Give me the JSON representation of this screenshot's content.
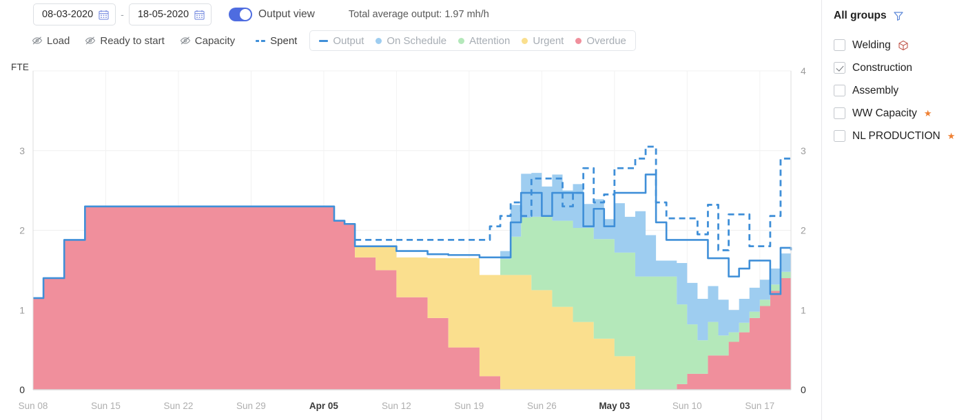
{
  "toolbar": {
    "date_from": "08-03-2020",
    "date_to": "18-05-2020",
    "date_separator": "-",
    "calendar_icon": "calendar-icon",
    "toggle_label": "Output view",
    "toggle_on": true,
    "total_average": "Total average output: 1.97 mh/h",
    "hidden_series": [
      {
        "label": "Load",
        "icon": "eye-slash-icon"
      },
      {
        "label": "Ready to start",
        "icon": "eye-slash-icon"
      },
      {
        "label": "Capacity",
        "icon": "eye-slash-icon"
      }
    ],
    "spent": {
      "label": "Spent",
      "color": "#3f8fd8"
    },
    "legend": [
      {
        "label": "Output",
        "color": "#3f8fd8",
        "marker": "line"
      },
      {
        "label": "On Schedule",
        "color": "#9ecdf0",
        "marker": "dot"
      },
      {
        "label": "Attention",
        "color": "#b4e8ba",
        "marker": "dot"
      },
      {
        "label": "Urgent",
        "color": "#fadf8e",
        "marker": "dot"
      },
      {
        "label": "Overdue",
        "color": "#f08f9c",
        "marker": "dot"
      }
    ]
  },
  "groups": {
    "title": "All groups",
    "filter_icon": "funnel-icon",
    "items": [
      {
        "label": "Welding",
        "checked": false,
        "badge": "cube-icon"
      },
      {
        "label": "Construction",
        "checked": true,
        "badge": ""
      },
      {
        "label": "Assembly",
        "checked": false,
        "badge": ""
      },
      {
        "label": "WW Capacity",
        "checked": false,
        "badge": "star-icon"
      },
      {
        "label": "NL PRODUCTION",
        "checked": false,
        "badge": "star-icon"
      }
    ]
  },
  "chart_data": {
    "type": "area",
    "title": "",
    "ylabel": "FTE",
    "xlabel": "",
    "ylim": [
      0,
      4
    ],
    "y_ticks": [
      0,
      1,
      2,
      3,
      4
    ],
    "y_ticks_left": [
      0,
      1,
      2,
      3
    ],
    "y_ticks_right": [
      0,
      1,
      2,
      3,
      4
    ],
    "grid": true,
    "legend_position": "top",
    "x_tick_labels": [
      "Sun 08",
      "Sun 15",
      "Sun 22",
      "Sun 29",
      "Apr 05",
      "Sun 12",
      "Sun 19",
      "Sun 26",
      "May 03",
      "Sun 10",
      "Sun 17"
    ],
    "x_tick_emphasis": [
      false,
      false,
      false,
      false,
      true,
      false,
      false,
      false,
      true,
      false,
      false
    ],
    "x": [
      0,
      1,
      2,
      3,
      4,
      5,
      6,
      7,
      8,
      9,
      10,
      11,
      12,
      13,
      14,
      15,
      16,
      17,
      18,
      19,
      20,
      21,
      22,
      23,
      24,
      25,
      26,
      27,
      28,
      29,
      30,
      31,
      32,
      33,
      34,
      35,
      36,
      37,
      38,
      39,
      40,
      41,
      42,
      43,
      44,
      45,
      46,
      47,
      48,
      49,
      50,
      51,
      52,
      53,
      54,
      55,
      56,
      57,
      58,
      59,
      60,
      61,
      62,
      63,
      64,
      65,
      66,
      67,
      68,
      69,
      70,
      71,
      72,
      73
    ],
    "stack_order": [
      "Overdue",
      "Urgent",
      "Attention",
      "On Schedule"
    ],
    "series": [
      {
        "name": "Overdue",
        "color": "#f08f9c",
        "values": [
          1.15,
          1.4,
          1.4,
          1.88,
          1.88,
          2.3,
          2.3,
          2.3,
          2.3,
          2.3,
          2.3,
          2.3,
          2.3,
          2.3,
          2.3,
          2.3,
          2.3,
          2.3,
          2.3,
          2.3,
          2.3,
          2.3,
          2.3,
          2.3,
          2.3,
          2.3,
          2.3,
          2.3,
          2.3,
          2.12,
          2.08,
          1.66,
          1.66,
          1.5,
          1.5,
          1.16,
          1.16,
          1.16,
          0.9,
          0.9,
          0.53,
          0.53,
          0.53,
          0.17,
          0.17,
          0.0,
          0.0,
          0.0,
          0.0,
          0.0,
          0.0,
          0.0,
          0.0,
          0.0,
          0.0,
          0.0,
          0.0,
          0.0,
          0.0,
          0.0,
          0.0,
          0.0,
          0.07,
          0.2,
          0.2,
          0.43,
          0.43,
          0.6,
          0.72,
          0.9,
          1.05,
          1.24,
          1.4,
          1.55
        ]
      },
      {
        "name": "Urgent",
        "color": "#fadf8e",
        "values": [
          0,
          0,
          0,
          0,
          0,
          0,
          0,
          0,
          0,
          0,
          0,
          0,
          0,
          0,
          0,
          0,
          0,
          0,
          0,
          0,
          0,
          0,
          0,
          0,
          0,
          0,
          0,
          0,
          0,
          0,
          0,
          0.14,
          0.14,
          0.3,
          0.3,
          0.5,
          0.5,
          0.5,
          0.75,
          0.75,
          1.12,
          1.12,
          1.12,
          1.27,
          1.27,
          1.44,
          1.44,
          1.44,
          1.25,
          1.25,
          1.04,
          1.04,
          0.85,
          0.85,
          0.64,
          0.64,
          0.42,
          0.42,
          0.0,
          0.0,
          0.0,
          0.0,
          0.0,
          0.0,
          0.0,
          0.0,
          0.0,
          0.0,
          0.0,
          0.0,
          0.0,
          0.0,
          0.0,
          0.0
        ]
      },
      {
        "name": "Attention",
        "color": "#b4e8ba",
        "values": [
          0,
          0,
          0,
          0,
          0,
          0,
          0,
          0,
          0,
          0,
          0,
          0,
          0,
          0,
          0,
          0,
          0,
          0,
          0,
          0,
          0,
          0,
          0,
          0,
          0,
          0,
          0,
          0,
          0,
          0,
          0,
          0,
          0,
          0,
          0,
          0,
          0,
          0,
          0,
          0,
          0,
          0,
          0,
          0,
          0,
          0.2,
          0.48,
          0.72,
          0.92,
          0.92,
          1.08,
          1.08,
          1.18,
          1.18,
          1.25,
          1.25,
          1.3,
          1.3,
          1.42,
          1.42,
          1.42,
          1.42,
          1.0,
          0.62,
          0.42,
          0.42,
          0.25,
          0.12,
          0.12,
          0.08,
          0.08,
          0.08,
          0.08,
          0.08
        ]
      },
      {
        "name": "On Schedule",
        "color": "#9ecdf0",
        "values": [
          0,
          0,
          0,
          0,
          0,
          0,
          0,
          0,
          0,
          0,
          0,
          0,
          0,
          0,
          0,
          0,
          0,
          0,
          0,
          0,
          0,
          0,
          0,
          0,
          0,
          0,
          0,
          0,
          0,
          0,
          0,
          0,
          0,
          0,
          0,
          0,
          0,
          0,
          0,
          0,
          0,
          0,
          0,
          0,
          0,
          0.1,
          0.4,
          0.55,
          0.55,
          0.38,
          0.58,
          0.38,
          0.55,
          0.3,
          0.5,
          0.25,
          0.62,
          0.45,
          0.82,
          0.52,
          0.2,
          0.2,
          0.52,
          0.52,
          0.52,
          0.45,
          0.45,
          0.28,
          0.3,
          0.3,
          0.25,
          0.2,
          0.23,
          0.15
        ]
      }
    ],
    "lines": [
      {
        "name": "Output",
        "color": "#3f8fd8",
        "style": "solid",
        "values": [
          1.15,
          1.4,
          1.4,
          1.88,
          1.88,
          2.3,
          2.3,
          2.3,
          2.3,
          2.3,
          2.3,
          2.3,
          2.3,
          2.3,
          2.3,
          2.3,
          2.3,
          2.3,
          2.3,
          2.3,
          2.3,
          2.3,
          2.3,
          2.3,
          2.3,
          2.3,
          2.3,
          2.3,
          2.3,
          2.12,
          2.08,
          1.8,
          1.8,
          1.8,
          1.8,
          1.74,
          1.74,
          1.74,
          1.7,
          1.7,
          1.69,
          1.69,
          1.69,
          1.66,
          1.66,
          1.66,
          2.1,
          2.47,
          2.47,
          2.18,
          2.47,
          2.47,
          2.47,
          2.05,
          2.27,
          2.05,
          2.47,
          2.47,
          2.47,
          2.7,
          2.1,
          1.88,
          1.88,
          1.88,
          1.88,
          1.65,
          1.65,
          1.42,
          1.52,
          1.62,
          1.62,
          1.2,
          1.78,
          1.75
        ]
      },
      {
        "name": "Spent",
        "color": "#3f8fd8",
        "style": "dashed",
        "values": [
          null,
          null,
          null,
          null,
          null,
          null,
          null,
          null,
          null,
          null,
          null,
          null,
          null,
          null,
          null,
          null,
          null,
          null,
          null,
          null,
          null,
          null,
          null,
          null,
          null,
          null,
          null,
          null,
          null,
          null,
          null,
          1.88,
          1.88,
          1.88,
          1.88,
          1.88,
          1.88,
          1.88,
          1.88,
          1.88,
          1.88,
          1.88,
          1.88,
          1.88,
          2.05,
          2.18,
          2.35,
          2.18,
          2.65,
          2.65,
          2.65,
          2.3,
          2.47,
          2.78,
          2.35,
          2.45,
          2.78,
          2.78,
          2.9,
          3.05,
          2.35,
          2.15,
          2.15,
          2.15,
          1.95,
          2.32,
          1.75,
          2.2,
          2.2,
          1.8,
          1.8,
          2.18,
          2.9,
          2.9
        ]
      }
    ]
  }
}
